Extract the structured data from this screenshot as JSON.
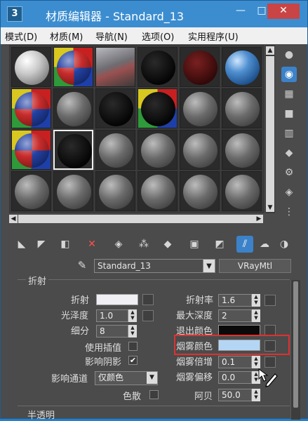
{
  "window": {
    "title": "材质编辑器 - Standard_13",
    "app_icon": "3",
    "minimize": "—",
    "maximize": "□",
    "close": "✕"
  },
  "menu": [
    {
      "label": "模式(D)"
    },
    {
      "label": "材质(M)"
    },
    {
      "label": "导航(N)"
    },
    {
      "label": "选项(O)"
    },
    {
      "label": "实用程序(U)"
    }
  ],
  "slots": {
    "rows": 4,
    "cols": 6,
    "checker_slots": [
      1,
      6,
      9,
      12
    ],
    "dark_slots": [
      3,
      4,
      8,
      9,
      13
    ],
    "selected_slot": 13,
    "sphere_icon": "material-sphere-icon"
  },
  "side_tools": [
    {
      "icon": "sample-type-icon"
    },
    {
      "icon": "backlight-icon"
    },
    {
      "icon": "background-checker-icon"
    },
    {
      "icon": "sample-uv-tiling-icon"
    },
    {
      "icon": "video-color-check-icon"
    },
    {
      "icon": "make-preview-icon"
    },
    {
      "icon": "options-icon"
    },
    {
      "icon": "select-by-material-icon"
    },
    {
      "icon": "material-map-navigator-icon"
    }
  ],
  "toolbar": [
    {
      "icon": "get-material-icon"
    },
    {
      "icon": "put-to-scene-icon"
    },
    {
      "icon": "assign-to-selection-icon"
    },
    {
      "icon": "reset-map-icon"
    },
    {
      "icon": "make-unique-icon"
    },
    {
      "icon": "put-to-library-icon"
    },
    {
      "icon": "material-id-channel-icon"
    },
    {
      "icon": "show-shaded-material-icon"
    },
    {
      "icon": "show-end-result-icon"
    },
    {
      "icon": "go-to-parent-icon"
    },
    {
      "icon": "go-forward-sibling-icon"
    },
    {
      "icon": "pick-from-object-icon"
    }
  ],
  "material": {
    "name": "Standard_13",
    "type": "VRayMtl"
  },
  "refraction": {
    "section_title": "折射",
    "refract_label": "折射",
    "refract_color": "#efeff4",
    "glossiness_label": "光泽度",
    "glossiness": "1.0",
    "subdivs_label": "细分",
    "subdivs": "8",
    "use_interp_label": "使用插值",
    "affect_shadows_label": "影响阴影",
    "affect_shadows_check": "✔",
    "affect_channels_label": "影响通道",
    "affect_channels": "仅颜色",
    "dispersion_label": "色散",
    "ior_label": "折射率",
    "ior": "1.6",
    "max_depth_label": "最大深度",
    "max_depth": "2",
    "exit_color_label": "退出颜色",
    "exit_color": "#0a0a0a",
    "fog_color_label": "烟雾颜色",
    "fog_color": "#b4d6f4",
    "fog_multiplier_label": "烟雾倍增",
    "fog_multiplier": "0.1",
    "fog_bias_label": "烟雾偏移",
    "fog_bias": "0.0",
    "abbe_label": "阿贝",
    "abbe": "50.0"
  },
  "translucency_title": "半透明",
  "highlight_color": "#e03030"
}
